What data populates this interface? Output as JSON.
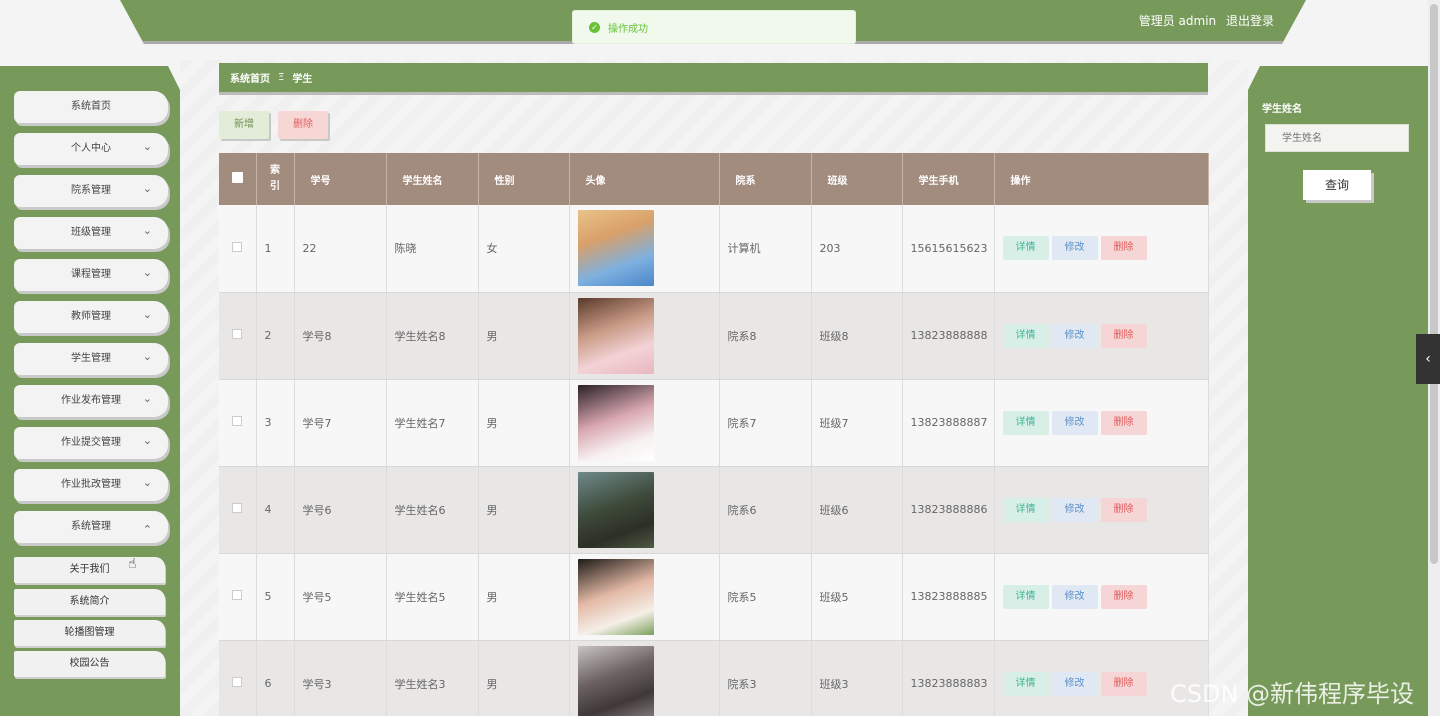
{
  "header": {
    "user_label": "管理员 admin",
    "logout_label": "退出登录"
  },
  "toast": {
    "message": "操作成功",
    "icon": "check-circle-icon"
  },
  "sidebar": {
    "items": [
      {
        "label": "系统首页"
      },
      {
        "label": "个人中心"
      },
      {
        "label": "院系管理"
      },
      {
        "label": "班级管理"
      },
      {
        "label": "课程管理"
      },
      {
        "label": "教师管理"
      },
      {
        "label": "学生管理"
      },
      {
        "label": "作业发布管理"
      },
      {
        "label": "作业提交管理"
      },
      {
        "label": "作业批改管理"
      },
      {
        "label": "系统管理"
      }
    ],
    "subitems": [
      {
        "label": "关于我们"
      },
      {
        "label": "系统简介"
      },
      {
        "label": "轮播图管理"
      },
      {
        "label": "校园公告"
      }
    ]
  },
  "breadcrumb": {
    "home": "系统首页",
    "separator": "Ξ",
    "current": "学生"
  },
  "actions": {
    "add_label": "新增",
    "delete_label": "删除"
  },
  "table": {
    "headers": [
      "索引",
      "学号",
      "学生姓名",
      "性别",
      "头像",
      "院系",
      "班级",
      "学生手机",
      "操作"
    ],
    "index_header_line1": "索",
    "index_header_line2": "引",
    "op_labels": {
      "detail": "详情",
      "edit": "修改",
      "delete": "删除"
    },
    "rows": [
      {
        "index": "1",
        "id": "22",
        "name": "陈晓",
        "gender": "女",
        "dept": "计算机",
        "class": "203",
        "phone": "15615615623"
      },
      {
        "index": "2",
        "id": "学号8",
        "name": "学生姓名8",
        "gender": "男",
        "dept": "院系8",
        "class": "班级8",
        "phone": "13823888888"
      },
      {
        "index": "3",
        "id": "学号7",
        "name": "学生姓名7",
        "gender": "男",
        "dept": "院系7",
        "class": "班级7",
        "phone": "13823888887"
      },
      {
        "index": "4",
        "id": "学号6",
        "name": "学生姓名6",
        "gender": "男",
        "dept": "院系6",
        "class": "班级6",
        "phone": "13823888886"
      },
      {
        "index": "5",
        "id": "学号5",
        "name": "学生姓名5",
        "gender": "男",
        "dept": "院系5",
        "class": "班级5",
        "phone": "13823888885"
      },
      {
        "index": "6",
        "id": "学号3",
        "name": "学生姓名3",
        "gender": "男",
        "dept": "院系3",
        "class": "班级3",
        "phone": "13823888883"
      }
    ]
  },
  "search_panel": {
    "label": "学生姓名",
    "placeholder": "学生姓名",
    "button": "查询"
  },
  "watermark": "CSDN @新伟程序毕设",
  "colors": {
    "accent": "#779a5b",
    "table_header": "#a28c7e"
  }
}
